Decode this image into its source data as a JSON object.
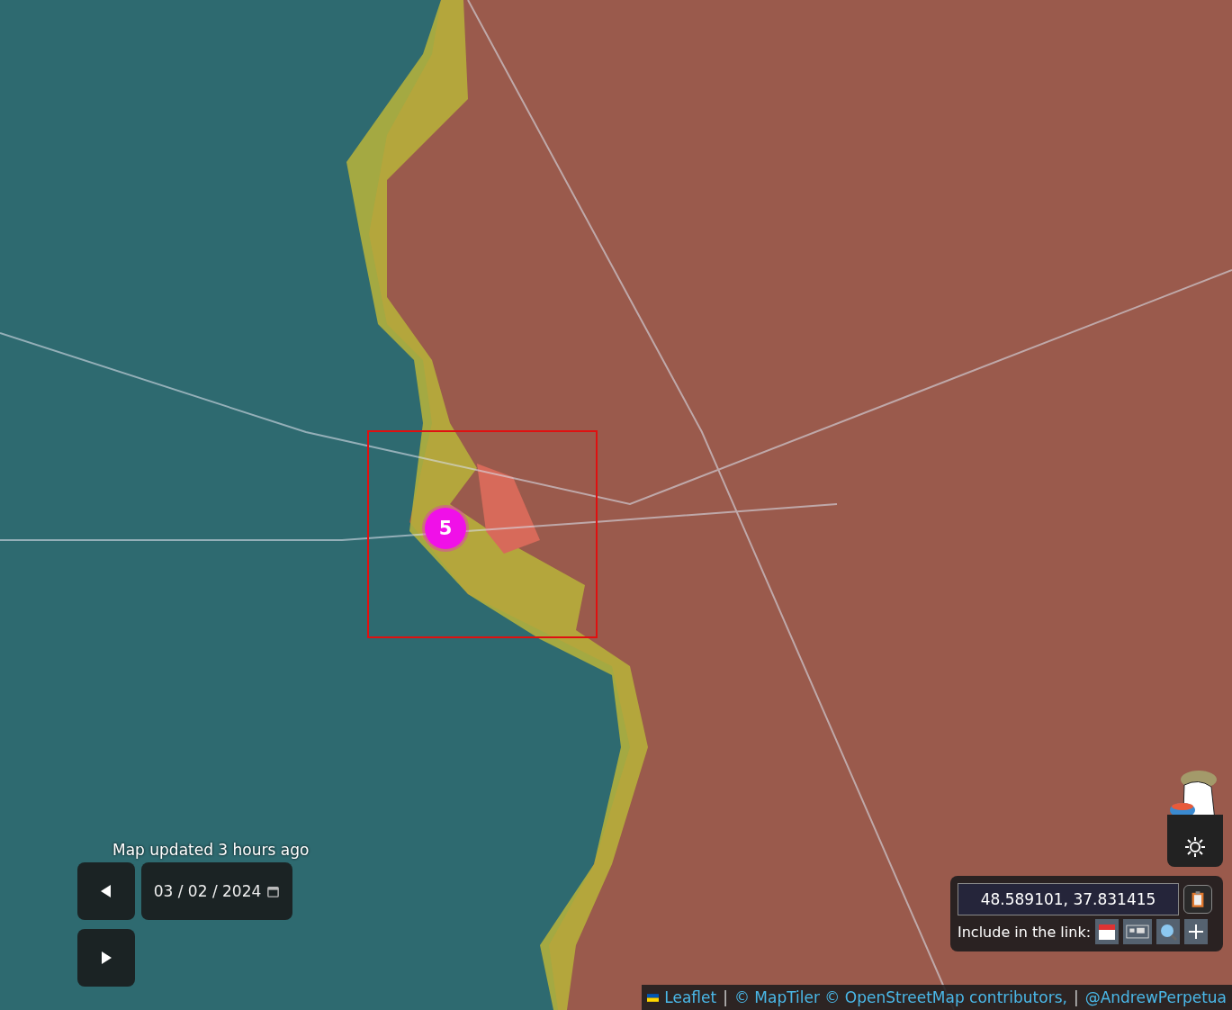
{
  "cluster_marker": {
    "count": "5"
  },
  "update_note": "Map updated 3 hours ago",
  "date_control": {
    "value": "03 / 02 / 2024"
  },
  "coordinates_panel": {
    "value": "48.589101, 37.831415",
    "include_label": "Include in the link:"
  },
  "attribution": [
    {
      "kind": "link",
      "text": "Leaflet"
    },
    {
      "kind": "separator",
      "text": "|"
    },
    {
      "kind": "link",
      "text": "© MapTiler © OpenStreetMap contributors,"
    },
    {
      "kind": "separator",
      "text": "|"
    },
    {
      "kind": "link",
      "text": "@AndrewPerpetua"
    }
  ]
}
